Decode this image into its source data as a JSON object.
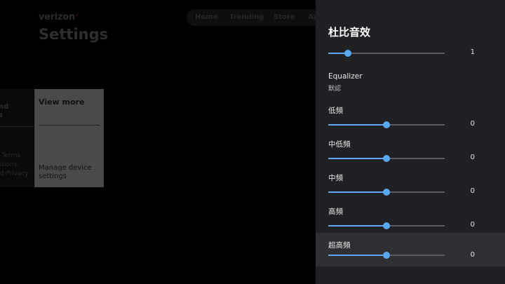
{
  "background": {
    "brand": "verizon",
    "page_title": "Settings",
    "nav": [
      "Home",
      "Trending",
      "Store",
      "Ap"
    ],
    "left_card_title": "nd\ns",
    "left_card_text": "e Terms\nditions,\nnd Privacy",
    "view_more": "View more",
    "manage_device": "Manage device settings"
  },
  "panel": {
    "title": "杜比音效",
    "top_slider": {
      "value": "1",
      "level": 0.17
    },
    "equalizer": {
      "label": "Equalizer",
      "value": "默認"
    },
    "bands": [
      {
        "label": "低頻",
        "value": "0",
        "level": 0.5,
        "focused": false
      },
      {
        "label": "中低頻",
        "value": "0",
        "level": 0.5,
        "focused": false
      },
      {
        "label": "中頻",
        "value": "0",
        "level": 0.5,
        "focused": false
      },
      {
        "label": "高頻",
        "value": "0",
        "level": 0.5,
        "focused": false
      },
      {
        "label": "超高頻",
        "value": "0",
        "level": 0.5,
        "focused": true
      }
    ],
    "accent_color": "#5aa8f0"
  }
}
